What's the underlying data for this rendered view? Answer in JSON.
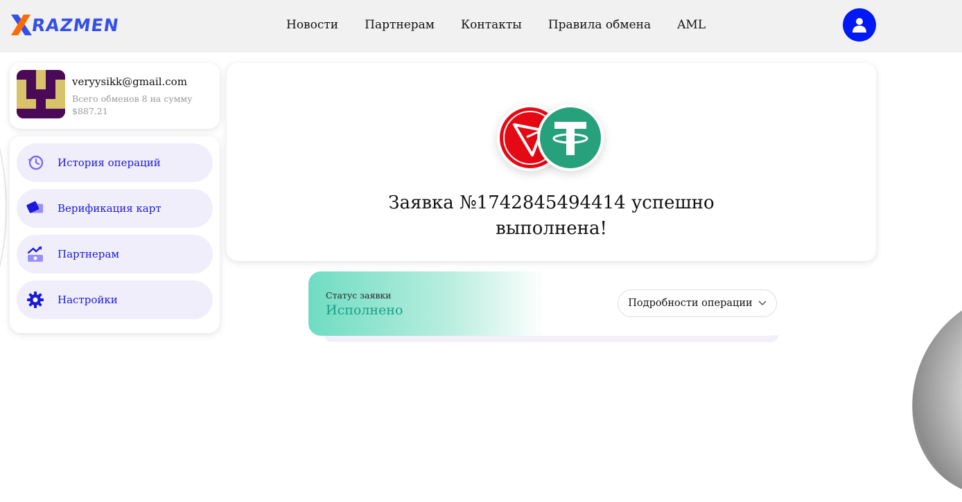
{
  "brand": {
    "logo_text": "RAZMEN",
    "accent": "#3550e8",
    "x_colors": [
      "#ff6a00",
      "#3550e8"
    ]
  },
  "nav": {
    "items": [
      {
        "label": "Новости"
      },
      {
        "label": "Партнерам"
      },
      {
        "label": "Контакты"
      },
      {
        "label": "Правила обмена"
      },
      {
        "label": "AML"
      }
    ]
  },
  "user_button": {
    "icon": "user-icon",
    "color": "#0019f5"
  },
  "profile": {
    "avatar_icon": "pixel-avatar",
    "email": "veryysikk@gmail.com",
    "stats_line1": "Всего обменов 8 на сумму",
    "stats_line2": "$887.21"
  },
  "menu": {
    "items": [
      {
        "label": "История операций",
        "icon": "history-icon"
      },
      {
        "label": "Верификация карт",
        "icon": "card-icon"
      },
      {
        "label": "Партнерам",
        "icon": "partners-icon"
      },
      {
        "label": "Настройки",
        "icon": "gear-icon"
      }
    ]
  },
  "result": {
    "from_coin": "tron-icon",
    "to_coin": "tether-icon",
    "title_line1": "Заявка №1742845494414 успешно",
    "title_line2": "выполнена!"
  },
  "status": {
    "label": "Статус заявки",
    "value": "Исполнено",
    "value_color": "#1aa083",
    "details_label": "Подробности операции"
  }
}
